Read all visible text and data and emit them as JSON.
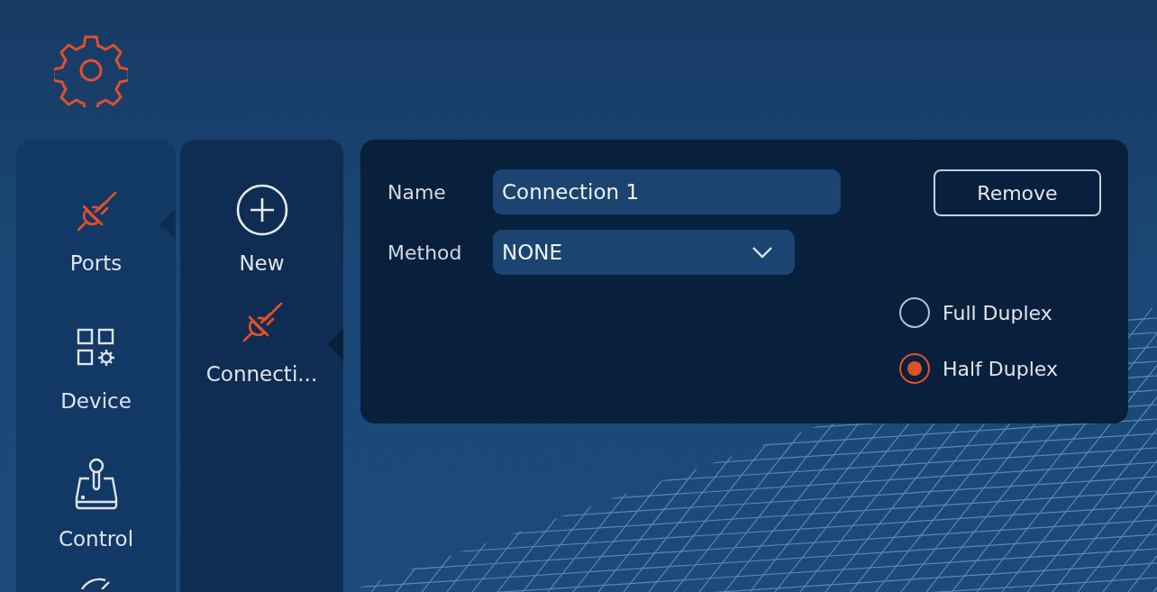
{
  "sidebar": {
    "items": [
      {
        "kind": "plug",
        "label": "Ports",
        "selected": true
      },
      {
        "kind": "device",
        "label": "Device",
        "selected": false
      },
      {
        "kind": "joystick",
        "label": "Control",
        "selected": false
      },
      {
        "kind": "partial",
        "selected": false
      }
    ]
  },
  "connections": {
    "items": [
      {
        "kind": "add",
        "label": "New",
        "selected": false
      },
      {
        "kind": "plug",
        "label": "Connecti...",
        "selected": true
      }
    ]
  },
  "form": {
    "name_label": "Name",
    "name_value": "Connection 1",
    "method_label": "Method",
    "method_value": "NONE",
    "remove_button": "Remove",
    "duplex": [
      {
        "label": "Full Duplex",
        "selected": false
      },
      {
        "label": "Half Duplex",
        "selected": true
      }
    ]
  }
}
